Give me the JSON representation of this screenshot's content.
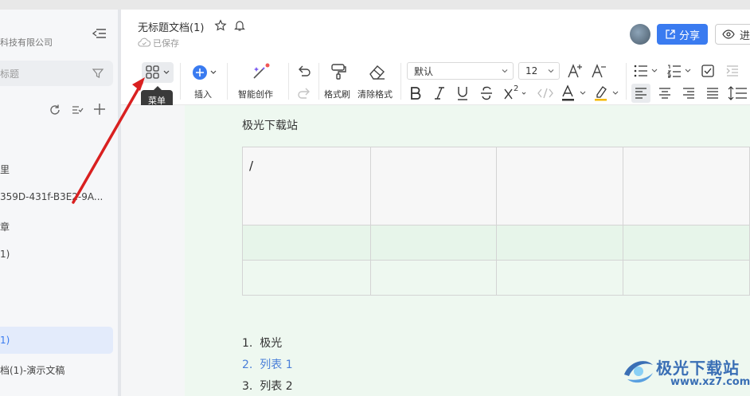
{
  "sidebar": {
    "company": "科技有限公司",
    "search_placeholder": "标题",
    "items": [
      {
        "label": "里"
      },
      {
        "label": "359D-431f-B3E2-9A..."
      },
      {
        "label": "章"
      },
      {
        "label": "1)"
      },
      {
        "label": "1)"
      },
      {
        "label": "档(1)-演示文稿"
      }
    ]
  },
  "header": {
    "title": "无标题文档(1)",
    "saved": "已保存",
    "share_label": "分享",
    "view_label": "进"
  },
  "toolbar": {
    "tooltip": "菜单",
    "insert_label": "插入",
    "ai_label": "智能创作",
    "format_brush_label": "格式刷",
    "clear_format_label": "清除格式",
    "font_family": "默认",
    "font_size": "12",
    "superscript_mark": "2",
    "colors": {
      "accent": "#3a7bf0",
      "insert_icon": "#3a7bf0",
      "font_color_bar": "#333333",
      "highlight_bar": "#f5b800"
    }
  },
  "document": {
    "heading": "极光下载站",
    "table": {
      "cell_0_0": "/",
      "rows": 3,
      "cols": 4
    },
    "list": [
      {
        "num": "1.",
        "text": "极光"
      },
      {
        "num": "2.",
        "text": "列表 1"
      },
      {
        "num": "3.",
        "text": "列表 2"
      }
    ]
  },
  "watermark": {
    "name": "极光下载站",
    "url": "www.xz7.com"
  }
}
